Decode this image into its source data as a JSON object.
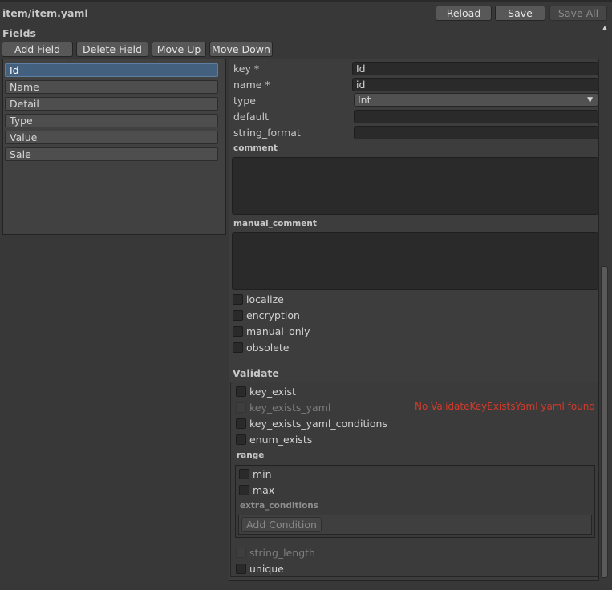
{
  "file_path": "item/item.yaml",
  "toolbar": {
    "reload": "Reload",
    "save": "Save",
    "save_all": "Save All"
  },
  "fields": {
    "title": "Fields",
    "add": "Add Field",
    "delete": "Delete Field",
    "move_up": "Move Up",
    "move_down": "Move Down",
    "items": [
      "Id",
      "Name",
      "Detail",
      "Type",
      "Value",
      "Sale"
    ]
  },
  "props": {
    "key_label": "key *",
    "key_value": "Id",
    "name_label": "name *",
    "name_value": "id",
    "type_label": "type",
    "type_value": "Int",
    "default_label": "default",
    "default_value": "",
    "string_format_label": "string_format",
    "string_format_value": "",
    "comment_label": "comment",
    "manual_comment_label": "manual_comment",
    "localize": "localize",
    "encryption": "encryption",
    "manual_only": "manual_only",
    "obsolete": "obsolete"
  },
  "validate": {
    "title": "Validate",
    "key_exist": "key_exist",
    "key_exists_yaml": "key_exists_yaml",
    "key_exists_yaml_warning": "No ValidateKeyExistsYaml yaml found",
    "key_exists_yaml_conditions": "key_exists_yaml_conditions",
    "enum_exists": "enum_exists",
    "range_title": "range",
    "min": "min",
    "max": "max",
    "extra_conditions": "extra_conditions",
    "add_condition": "Add Condition",
    "string_length": "string_length",
    "unique": "unique"
  },
  "colors": {
    "accent_selected": "#43607e",
    "warning": "#d43b2a"
  },
  "icons": {
    "dropdown": "chevron-down-icon",
    "scroll_up": "arrow-up-icon"
  }
}
